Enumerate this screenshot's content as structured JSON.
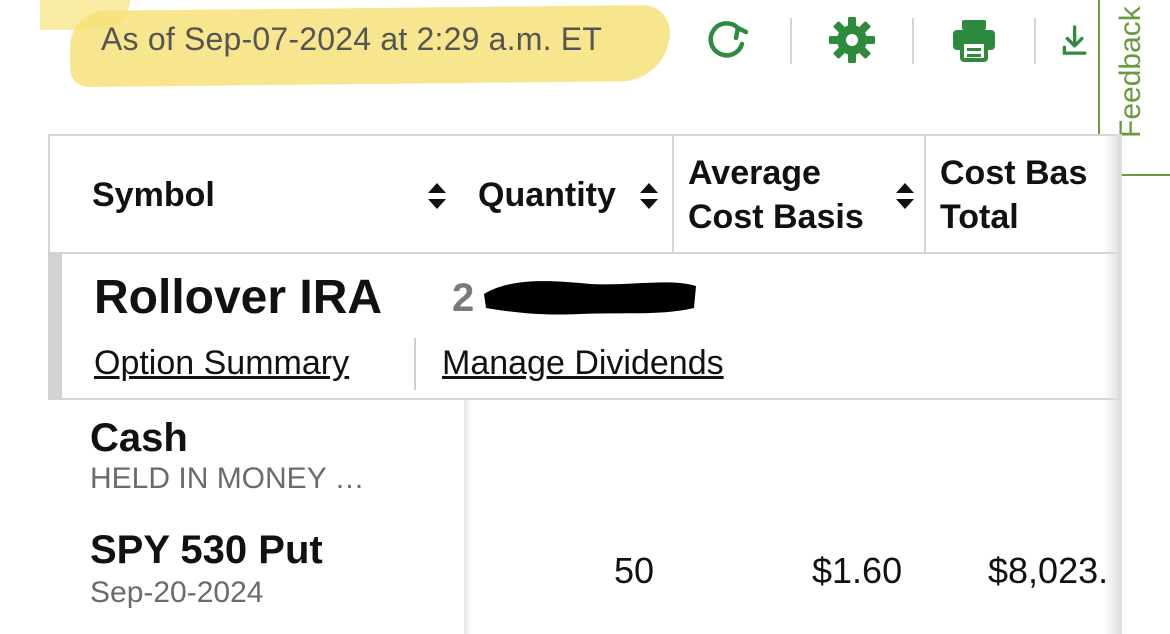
{
  "header": {
    "as_of": "As of Sep-07-2024 at 2:29 a.m. ET",
    "icons": [
      "refresh-icon",
      "gear-icon",
      "print-icon",
      "download-icon"
    ],
    "accent_color": "#2e8b3e"
  },
  "feedback": {
    "label": "Feedback"
  },
  "table": {
    "columns": {
      "symbol": "Symbol",
      "quantity": "Quantity",
      "avg_cost_1": "Average",
      "avg_cost_2": "Cost Basis",
      "cost_total_1": "Cost Bas",
      "cost_total_2": "Total"
    },
    "account": {
      "name": "Rollover IRA",
      "number_partial": "2",
      "links": {
        "option_summary": "Option Summary",
        "manage_dividends": "Manage Dividends"
      }
    },
    "rows": [
      {
        "name": "Cash",
        "sub": "HELD IN MONEY …",
        "quantity": "",
        "avg_cost": "",
        "cost_total": ""
      },
      {
        "name": "SPY 530 Put",
        "sub": "Sep-20-2024",
        "quantity": "50",
        "avg_cost": "$1.60",
        "cost_total": "$8,023."
      }
    ]
  }
}
